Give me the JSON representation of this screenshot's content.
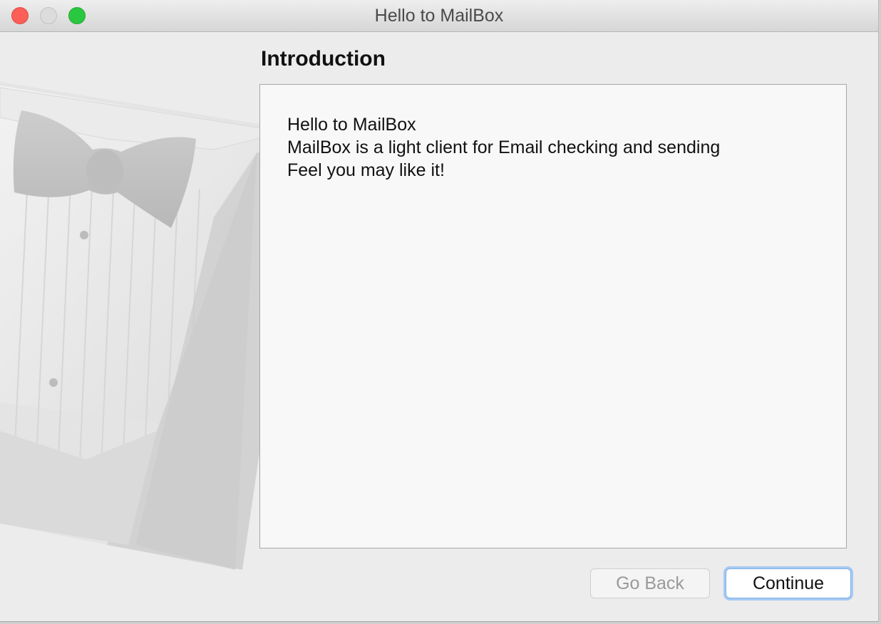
{
  "window": {
    "title": "Hello to MailBox"
  },
  "page": {
    "section_title": "Introduction",
    "lines": [
      "Hello to MailBox",
      "MailBox is a light client for Email checking and sending",
      "Feel you may like it!"
    ]
  },
  "buttons": {
    "back": "Go Back",
    "continue": "Continue"
  },
  "icons": {
    "artwork": "installer-tuxedo-artwork"
  },
  "colors": {
    "close": "#fc5f57",
    "zoom": "#2ac840",
    "focus_ring": "#a6c9f2"
  }
}
